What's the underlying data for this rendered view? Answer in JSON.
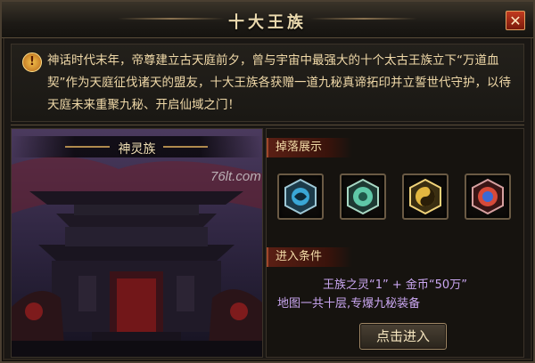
{
  "window": {
    "title": "十大王族",
    "close_label": "✕"
  },
  "intro": {
    "icon": "!",
    "text": "神话时代末年，帝尊建立古天庭前夕，曾与宇宙中最强大的十个太古王族立下“万道血契”作为天庭征伐诸天的盟友，十大王族各获赠一道九秘真谛拓印并立誓世代守护，以待天庭未来重聚九秘、开启仙域之门！"
  },
  "scene": {
    "name": "神灵族"
  },
  "drops": {
    "label": "掉落展示",
    "items": [
      {
        "name": "九秘宝珠-蓝",
        "color": "#3aa7d6"
      },
      {
        "name": "九秘宝珠-青",
        "color": "#5fc9a8"
      },
      {
        "name": "九秘宝珠-金",
        "color": "#e2b640"
      },
      {
        "name": "九秘宝珠-红",
        "color": "#d64a3a"
      }
    ]
  },
  "watermark": "76lt.com",
  "conditions": {
    "label": "进入条件",
    "line1": "王族之灵“1” + 金币“50万”",
    "line2": "地图一共十层,专爆九秘装备"
  },
  "enter_button": "点击进入"
}
